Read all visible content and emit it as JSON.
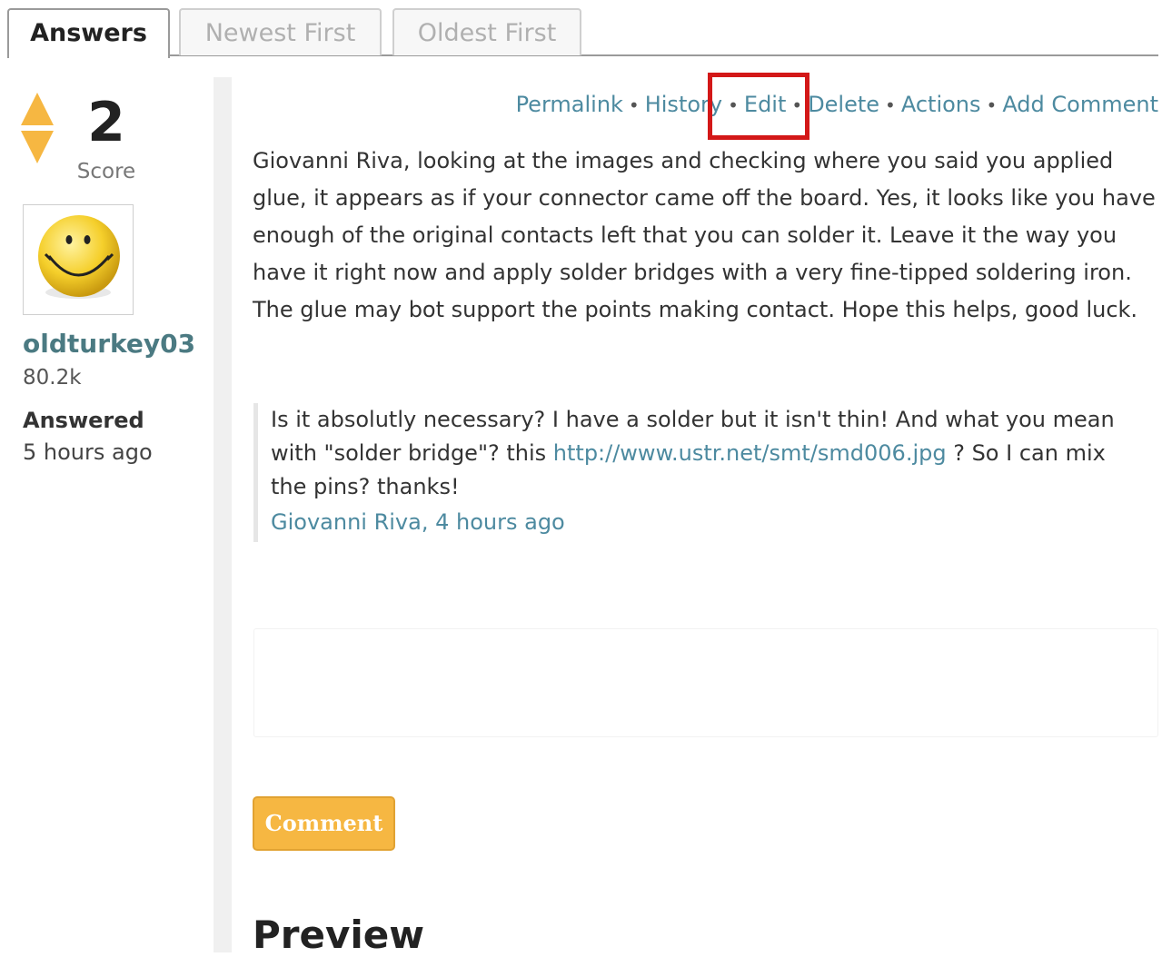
{
  "tabs": [
    {
      "label": "Answers",
      "active": true
    },
    {
      "label": "Newest First",
      "active": false
    },
    {
      "label": "Oldest First",
      "active": false
    }
  ],
  "vote": {
    "score": "2",
    "score_label": "Score",
    "arrow_color": "#f6b742"
  },
  "author": {
    "avatar_icon": "smiley-face-icon",
    "username": "oldturkey03",
    "reputation": "80.2k",
    "answered_label": "Answered",
    "answered_time": "5 hours ago"
  },
  "actions": {
    "permalink": "Permalink",
    "history": "History",
    "edit": "Edit",
    "delete": "Delete",
    "actions": "Actions",
    "add_comment": "Add Comment",
    "separator": "•",
    "highlight_color": "#d31818"
  },
  "answer": {
    "text": "Giovanni Riva, looking at the images and checking where you said you applied glue, it appears as if your connector came off the board. Yes, it looks like you have enough of the original contacts left that you can solder it. Leave it the way you have it right now and apply solder bridges with a very fine-tipped soldering iron. The glue may bot support the points making contact. Hope this helps, good luck."
  },
  "comment": {
    "text_before": "Is it absolutly necessary? I have a solder but it isn't thin! And what you mean with \"solder bridge\"? this ",
    "link": "http://www.ustr.net/smt/smd006.jpg",
    "text_after": " ? So I can mix the pins? thanks!",
    "author": "Giovanni Riva",
    "time": ", 4 hours ago"
  },
  "comment_form": {
    "button_label": "Comment",
    "button_color": "#f6b742"
  },
  "preview": {
    "heading": "Preview"
  },
  "colors": {
    "link": "#4d8aa0",
    "username": "#4b7a82"
  }
}
